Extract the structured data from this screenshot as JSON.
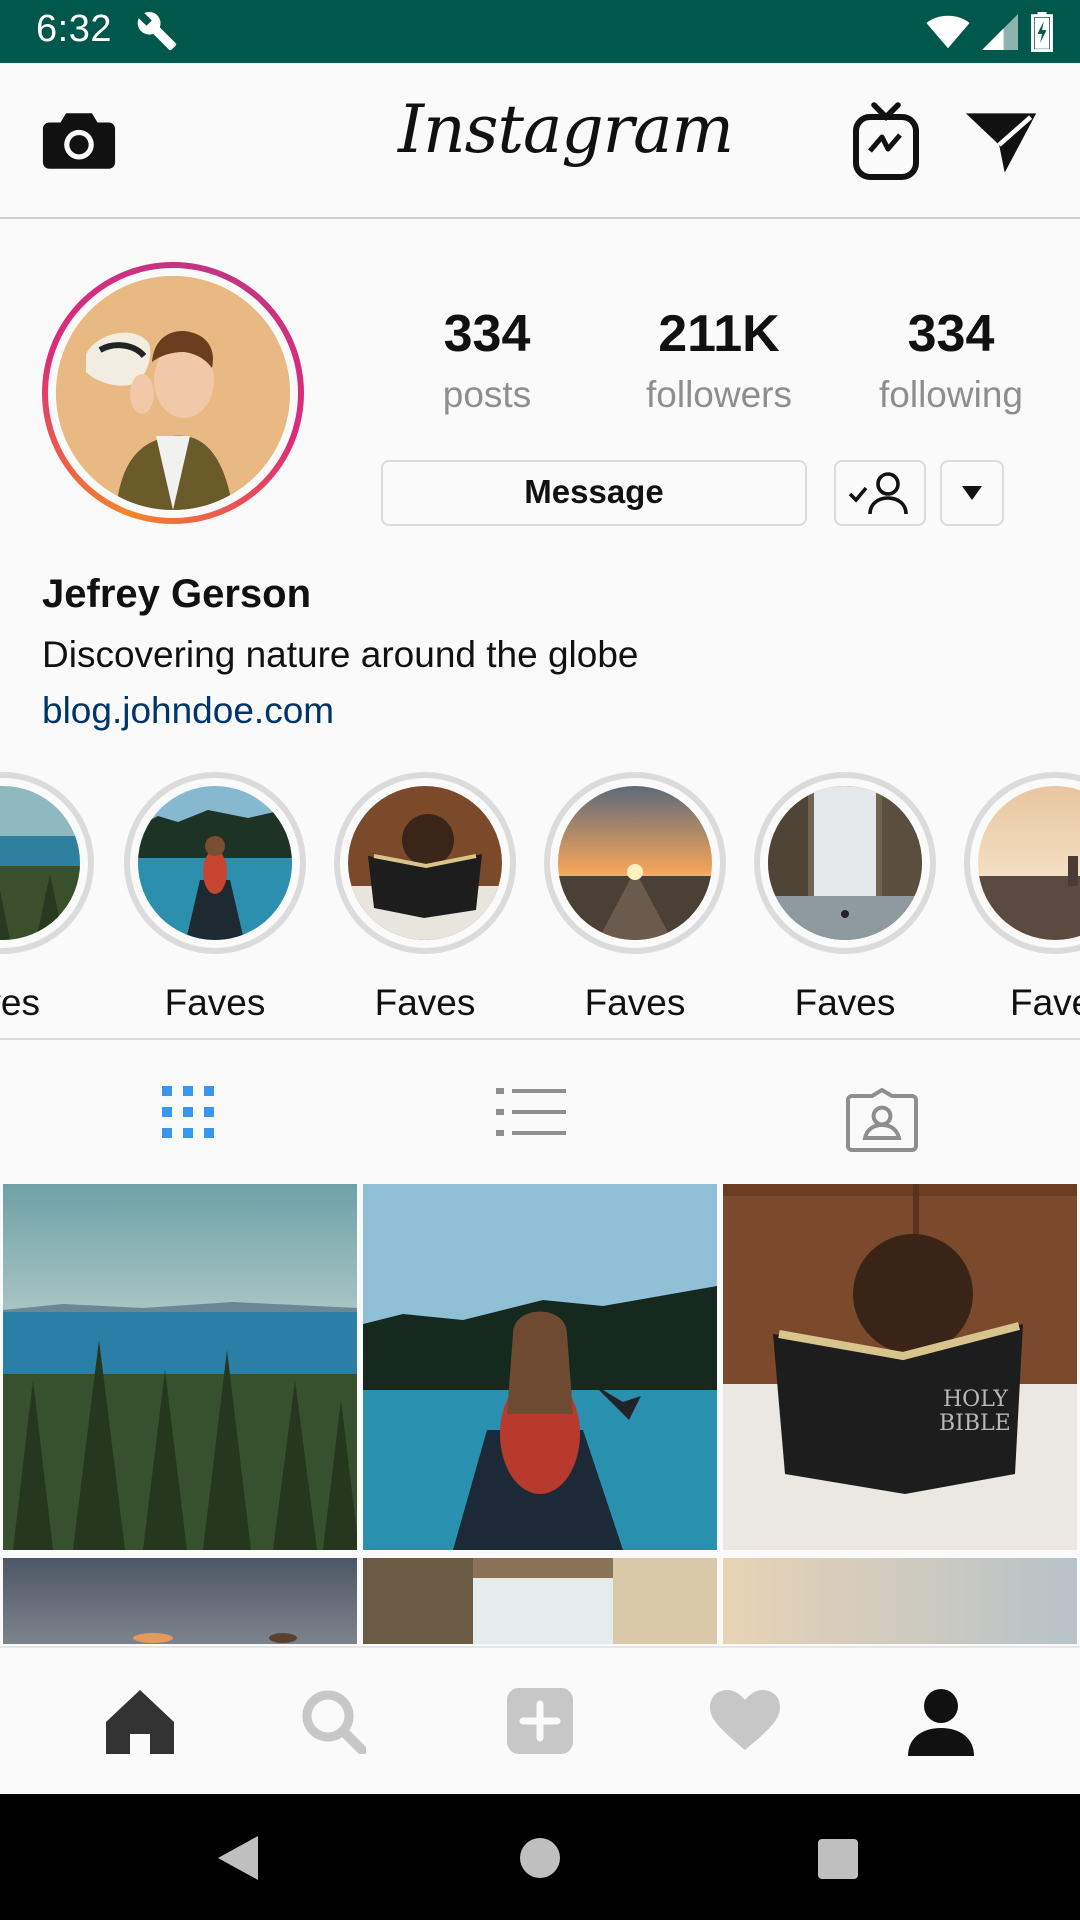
{
  "status_bar": {
    "time": "6:32",
    "wrench_icon": "wrench-icon",
    "wifi_icon": "wifi-icon",
    "signal_icon": "signal-icon",
    "battery_icon": "battery-charging-icon"
  },
  "app_bar": {
    "brand": "Instagram",
    "camera_icon": "camera-icon",
    "igtv_icon": "igtv-icon",
    "direct_icon": "direct-message-icon"
  },
  "profile": {
    "avatar_icon": "profile-photo",
    "stats": [
      {
        "value": "334",
        "label": "posts"
      },
      {
        "value": "211K",
        "label": "followers"
      },
      {
        "value": "334",
        "label": "following"
      }
    ],
    "message_label": "Message",
    "following_icon": "person-check-icon",
    "more_icon": "caret-down-icon",
    "name": "Jefrey Gerson",
    "bio": "Discovering nature around the globe",
    "link": "blog.johndoe.com"
  },
  "highlights": [
    {
      "label": "Faves"
    },
    {
      "label": "Faves"
    },
    {
      "label": "Faves"
    },
    {
      "label": "Faves"
    },
    {
      "label": "Faves"
    },
    {
      "label": "Faves"
    }
  ],
  "tabs": [
    {
      "icon": "grid-icon",
      "active": true
    },
    {
      "icon": "list-icon",
      "active": false
    },
    {
      "icon": "tagged-icon",
      "active": false
    }
  ],
  "bottom_nav": [
    {
      "icon": "home-icon"
    },
    {
      "icon": "search-icon"
    },
    {
      "icon": "add-post-icon"
    },
    {
      "icon": "heart-icon"
    },
    {
      "icon": "profile-icon"
    }
  ],
  "system_nav": [
    {
      "icon": "back-icon"
    },
    {
      "icon": "home-circle-icon"
    },
    {
      "icon": "recents-icon"
    }
  ],
  "colors": {
    "status_bar": "#00574b",
    "active_tab": "#3897f0",
    "link": "#003569",
    "muted": "#8e8e8e"
  }
}
